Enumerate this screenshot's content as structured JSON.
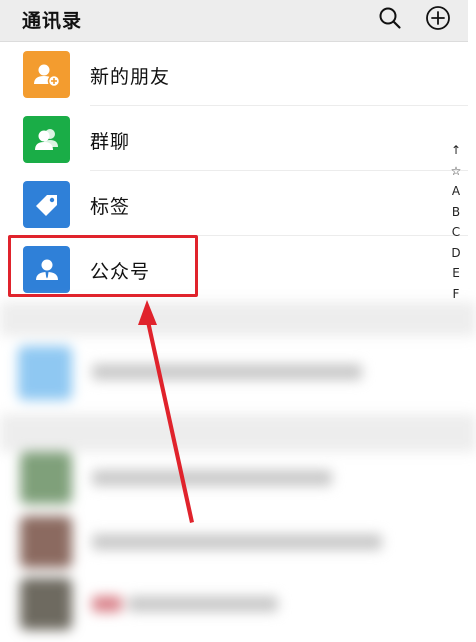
{
  "header": {
    "title": "通讯录",
    "search_icon": "search-icon",
    "add_icon": "add-circle-icon"
  },
  "menu_items": [
    {
      "label": "新的朋友",
      "icon": "add-friend-icon",
      "tile_color": "#f39c2f"
    },
    {
      "label": "群聊",
      "icon": "group-chat-icon",
      "tile_color": "#1aad47"
    },
    {
      "label": "标签",
      "icon": "tag-icon",
      "tile_color": "#2f80d8"
    },
    {
      "label": "公众号",
      "icon": "official-account-icon",
      "tile_color": "#2f80d8"
    }
  ],
  "index_bar": [
    "↑",
    "☆",
    "A",
    "B",
    "C",
    "D",
    "E",
    "F"
  ],
  "annotation": {
    "highlight_color": "#e0232c",
    "highlighted_item": "公众号"
  }
}
